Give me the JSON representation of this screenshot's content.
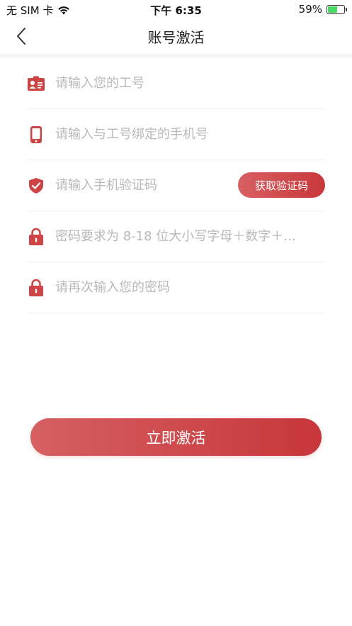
{
  "status_bar": {
    "carrier": "无 SIM 卡",
    "time": "下午 6:35",
    "battery": "59%",
    "battery_level": 0.59
  },
  "nav": {
    "title": "账号激活"
  },
  "form": {
    "employee_id_placeholder": "请输入您的工号",
    "phone_placeholder": "请输入与工号绑定的手机号",
    "code_placeholder": "请输入手机验证码",
    "get_code_label": "获取验证码",
    "password_placeholder": "密码要求为 8-18 位大小写字母＋数字＋...",
    "confirm_password_placeholder": "请再次输入您的密码"
  },
  "submit_label": "立即激活",
  "colors": {
    "accent": "#cc4446",
    "accent_light": "#d76062"
  }
}
